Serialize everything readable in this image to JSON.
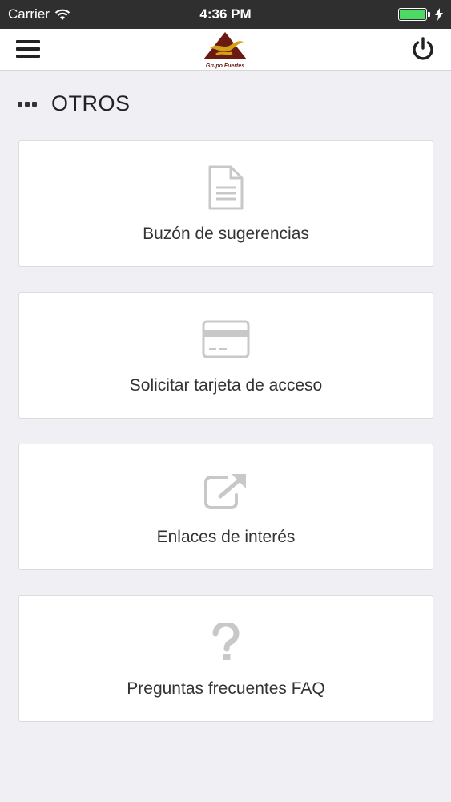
{
  "status_bar": {
    "carrier": "Carrier",
    "time": "4:36 PM",
    "battery_level": 1.0,
    "battery_color": "#4cd964"
  },
  "nav": {
    "menu_icon": "hamburger-icon",
    "logo_text": "Grupo Fuertes",
    "power_icon": "power-icon"
  },
  "section": {
    "icon": "ellipsis-icon",
    "title": "OTROS"
  },
  "items": [
    {
      "label": "Buzón de sugerencias",
      "icon": "document-icon"
    },
    {
      "label": "Solicitar tarjeta de acceso",
      "icon": "credit-card-icon"
    },
    {
      "label": "Enlaces de interés",
      "icon": "external-link-icon"
    },
    {
      "label": "Preguntas frecuentes FAQ",
      "icon": "question-icon"
    }
  ],
  "colors": {
    "background": "#f0eff4",
    "icon_gray": "#c8c8c8",
    "logo_brown": "#6b1a12",
    "logo_gold": "#d4a017"
  }
}
